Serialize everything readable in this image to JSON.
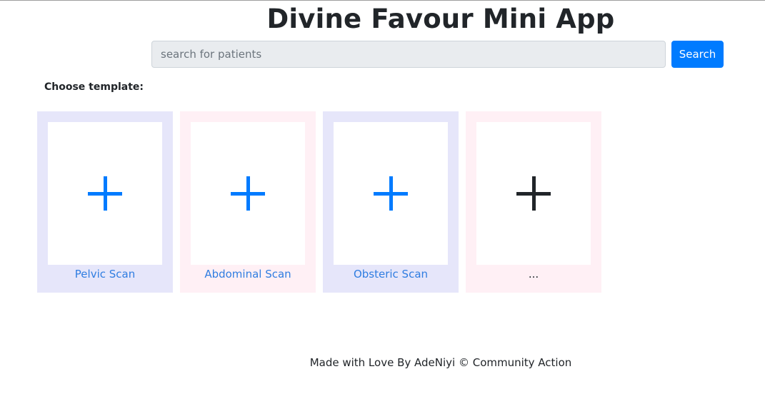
{
  "app": {
    "title": "Divine Favour Mini App"
  },
  "search": {
    "placeholder": "search for patients",
    "button_label": "Search"
  },
  "templates": {
    "heading": "Choose template:",
    "items": [
      {
        "label": "Pelvic Scan",
        "icon": "plus-icon",
        "color": "#007bff"
      },
      {
        "label": "Abdominal Scan",
        "icon": "plus-icon",
        "color": "#007bff"
      },
      {
        "label": "Obsteric Scan",
        "icon": "plus-icon",
        "color": "#007bff"
      },
      {
        "label": "...",
        "icon": "plus-icon",
        "color": "#212529"
      }
    ]
  },
  "footer": {
    "text": "Made with Love By AdeNiyi © Community Action"
  },
  "colors": {
    "primary": "#007bff",
    "card_lavender": "#e6e6fa",
    "card_pink": "#fff0f5"
  }
}
